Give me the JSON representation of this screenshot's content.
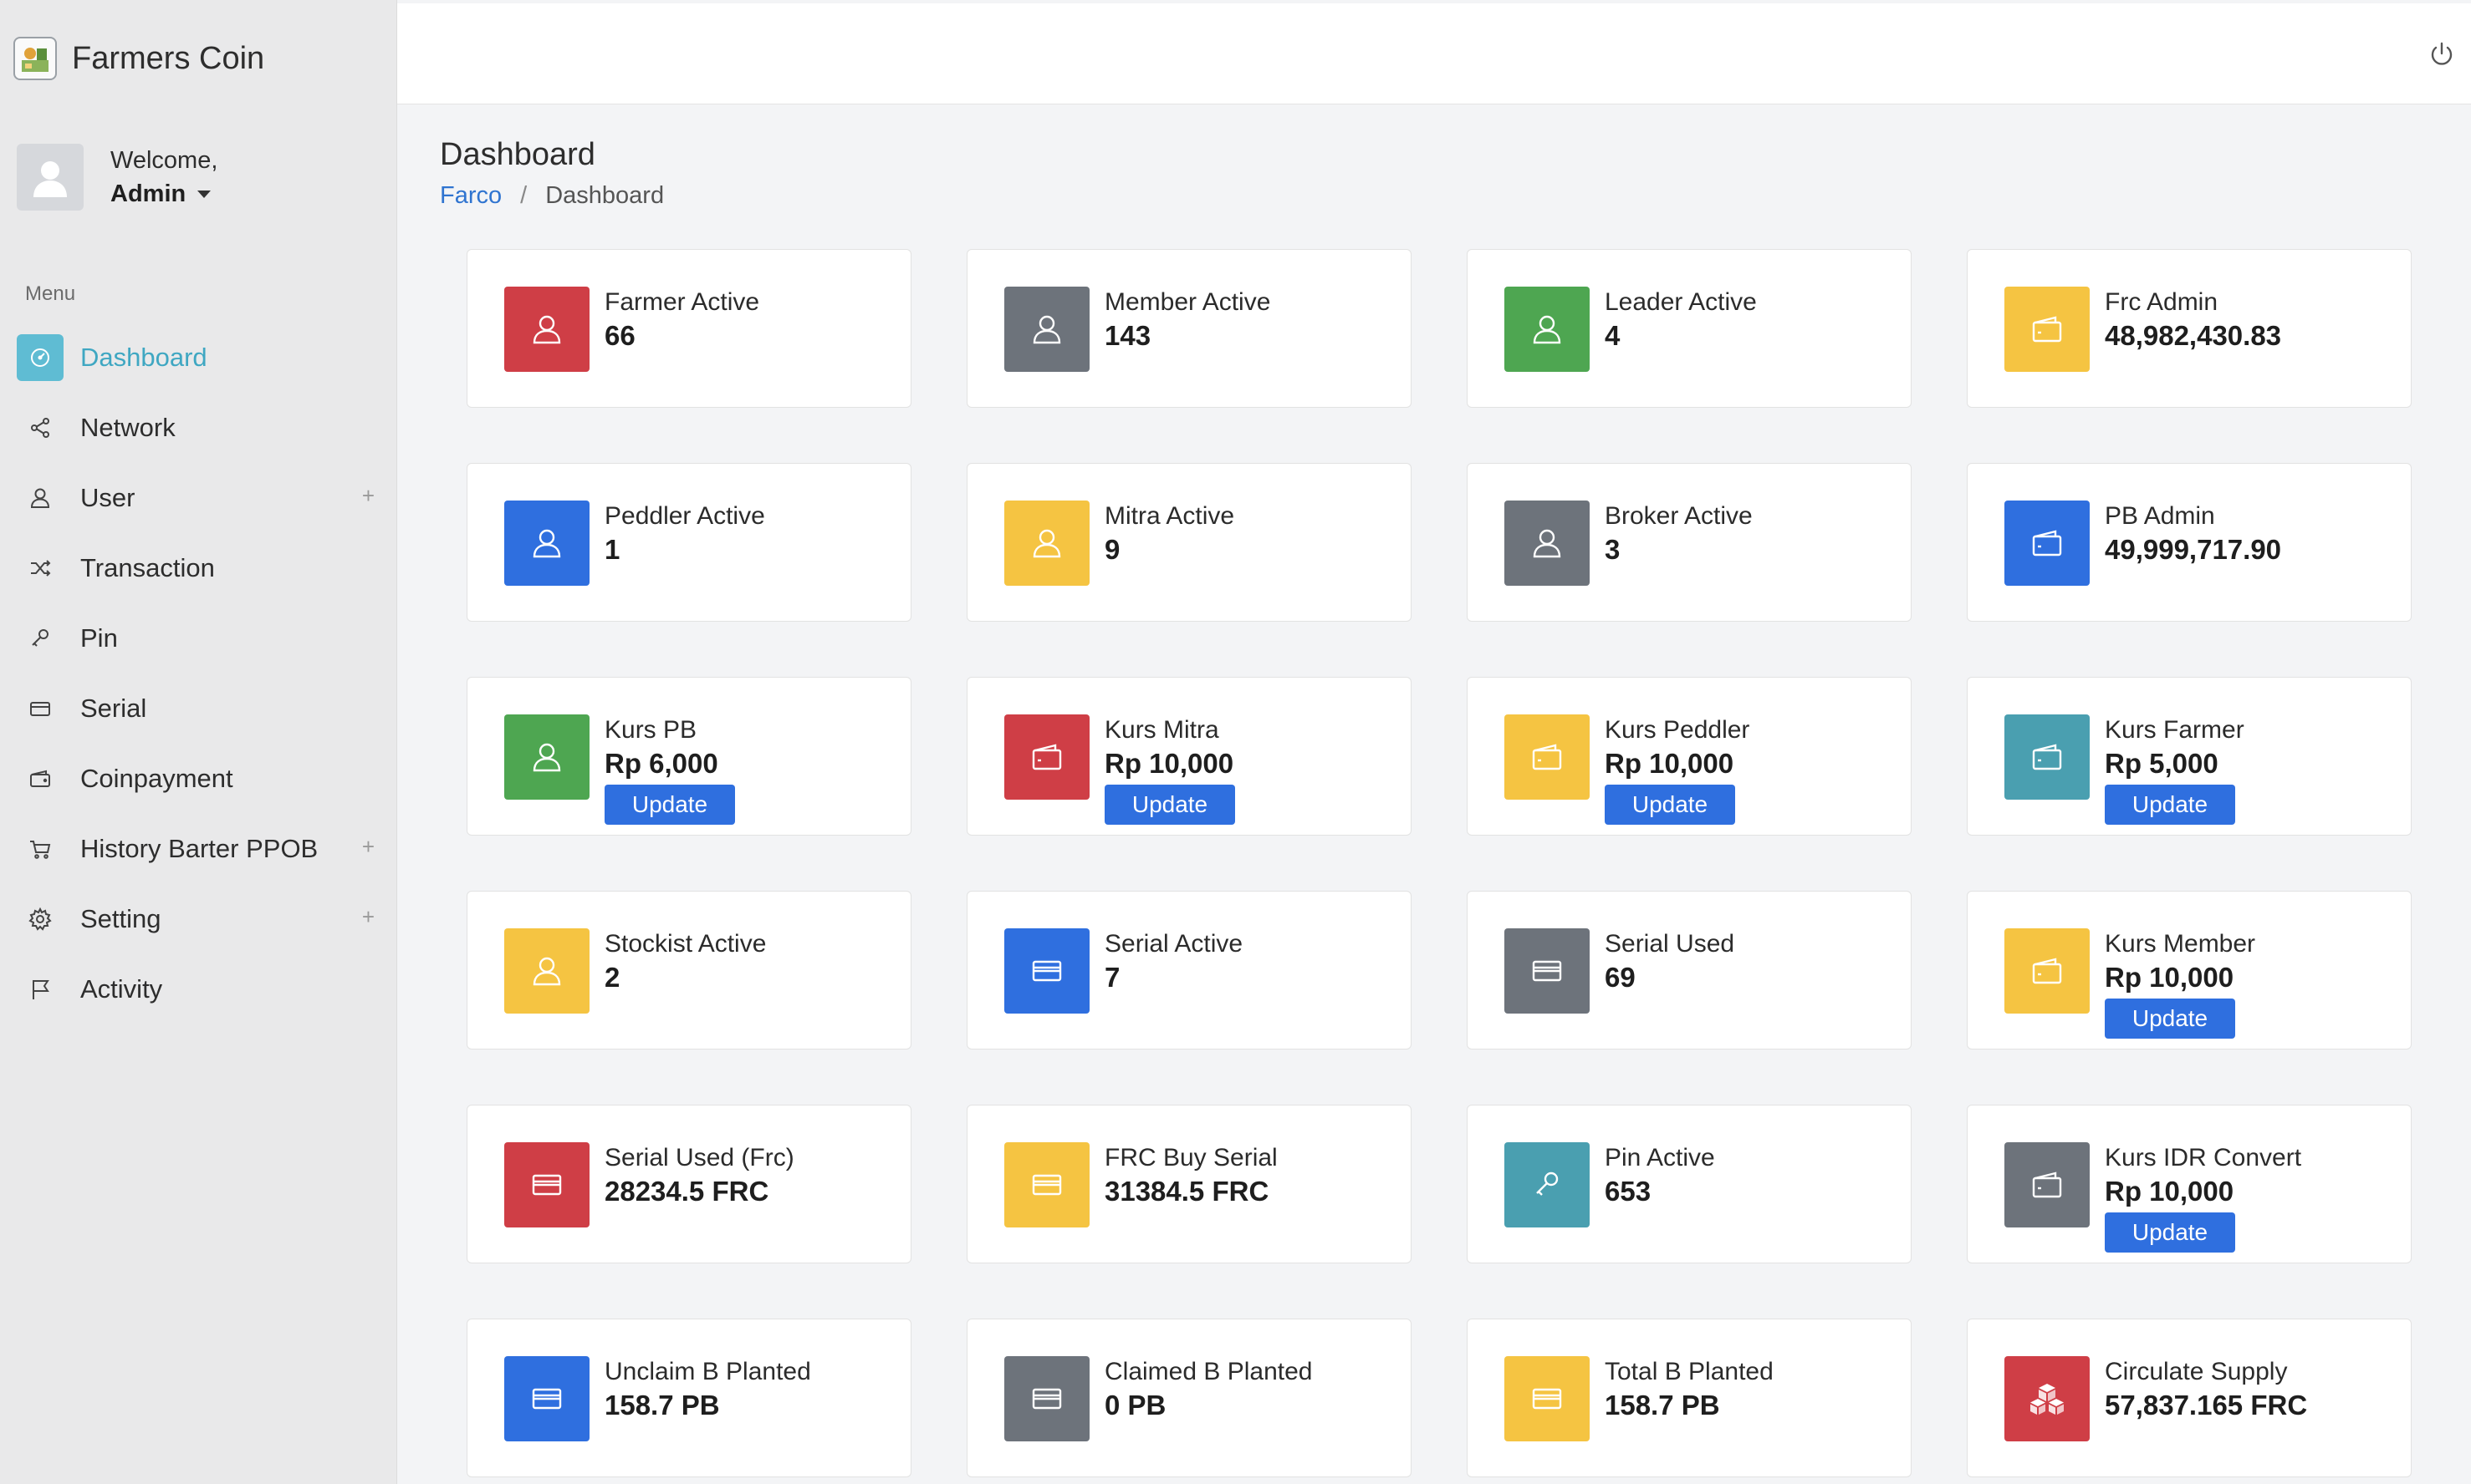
{
  "brand": {
    "title": "Farmers Coin"
  },
  "user": {
    "welcome": "Welcome,",
    "name": "Admin"
  },
  "menu": {
    "heading": "Menu",
    "items": [
      {
        "label": "Dashboard",
        "icon": "dashboard-icon",
        "active": true
      },
      {
        "label": "Network",
        "icon": "share-icon"
      },
      {
        "label": "User",
        "icon": "user-icon",
        "expandable": true
      },
      {
        "label": "Transaction",
        "icon": "shuffle-icon"
      },
      {
        "label": "Pin",
        "icon": "key-icon"
      },
      {
        "label": "Serial",
        "icon": "credit-card-icon"
      },
      {
        "label": "Coinpayment",
        "icon": "wallet-icon"
      },
      {
        "label": "History Barter PPOB",
        "icon": "cart-icon",
        "expandable": true
      },
      {
        "label": "Setting",
        "icon": "gear-icon",
        "expandable": true
      },
      {
        "label": "Activity",
        "icon": "flag-icon"
      }
    ],
    "plus_symbol": "+"
  },
  "page": {
    "title": "Dashboard"
  },
  "breadcrumb": {
    "root": "Farco",
    "separator": "/",
    "current": "Dashboard"
  },
  "colors": {
    "red": "#cf3e46",
    "gray": "#6d737b",
    "green": "#4ea651",
    "yellow": "#f5c442",
    "blue": "#2f6fdf",
    "teal": "#4a9fb0",
    "active_menu": "#5fbcd3",
    "link": "#2f74d0"
  },
  "update_label": "Update",
  "cards": [
    {
      "label": "Farmer Active",
      "value": "66",
      "color": "red",
      "icon": "user-icon"
    },
    {
      "label": "Member Active",
      "value": "143",
      "color": "gray",
      "icon": "user-icon"
    },
    {
      "label": "Leader Active",
      "value": "4",
      "color": "green",
      "icon": "user-icon"
    },
    {
      "label": "Frc Admin",
      "value": "48,982,430.83",
      "color": "yellow",
      "icon": "wallet-icon"
    },
    {
      "label": "Peddler Active",
      "value": "1",
      "color": "blue",
      "icon": "user-icon"
    },
    {
      "label": "Mitra Active",
      "value": "9",
      "color": "yellow",
      "icon": "user-icon"
    },
    {
      "label": "Broker Active",
      "value": "3",
      "color": "gray",
      "icon": "user-icon"
    },
    {
      "label": "PB Admin",
      "value": "49,999,717.90",
      "color": "blue",
      "icon": "wallet-icon"
    },
    {
      "label": "Kurs PB",
      "value": "Rp 6,000",
      "color": "green",
      "icon": "user-icon",
      "update": true
    },
    {
      "label": "Kurs Mitra",
      "value": "Rp 10,000",
      "color": "red",
      "icon": "wallet-icon",
      "update": true
    },
    {
      "label": "Kurs Peddler",
      "value": "Rp 10,000",
      "color": "yellow",
      "icon": "wallet-icon",
      "update": true
    },
    {
      "label": "Kurs Farmer",
      "value": "Rp 5,000",
      "color": "teal",
      "icon": "wallet-icon",
      "update": true
    },
    {
      "label": "Stockist Active",
      "value": "2",
      "color": "yellow",
      "icon": "user-icon"
    },
    {
      "label": "Serial Active",
      "value": "7",
      "color": "blue",
      "icon": "credit-card-icon"
    },
    {
      "label": "Serial Used",
      "value": "69",
      "color": "gray",
      "icon": "credit-card-icon"
    },
    {
      "label": "Kurs Member",
      "value": "Rp 10,000",
      "color": "yellow",
      "icon": "wallet-icon",
      "update": true
    },
    {
      "label": "Serial Used (Frc)",
      "value": "28234.5 FRC",
      "color": "red",
      "icon": "credit-card-icon"
    },
    {
      "label": "FRC Buy Serial",
      "value": "31384.5 FRC",
      "color": "yellow",
      "icon": "credit-card-icon"
    },
    {
      "label": "Pin Active",
      "value": "653",
      "color": "teal",
      "icon": "key-icon"
    },
    {
      "label": "Kurs IDR Convert",
      "value": "Rp 10,000",
      "color": "gray",
      "icon": "wallet-icon",
      "update": true
    },
    {
      "label": "Unclaim B Planted",
      "value": "158.7 PB",
      "color": "blue",
      "icon": "credit-card-icon"
    },
    {
      "label": "Claimed B Planted",
      "value": "0 PB",
      "color": "gray",
      "icon": "credit-card-icon"
    },
    {
      "label": "Total B Planted",
      "value": "158.7 PB",
      "color": "yellow",
      "icon": "credit-card-icon"
    },
    {
      "label": "Circulate Supply",
      "value": "57,837.165 FRC",
      "color": "red",
      "icon": "cubes-icon"
    }
  ]
}
